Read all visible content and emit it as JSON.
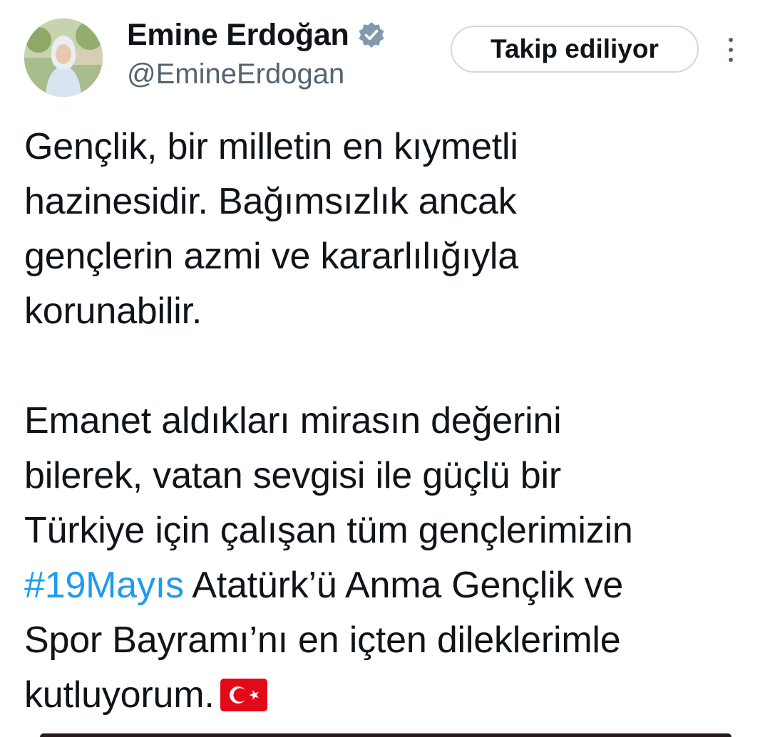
{
  "user": {
    "display_name": "Emine Erdoğan",
    "handle": "@EmineErdogan",
    "verified_badge_color": "#829aab"
  },
  "follow_button": {
    "label": "Takip ediliyor"
  },
  "tweet": {
    "paragraph1": [
      "Gençlik, bir milletin en kıymetli",
      "hazinesidir. Bağımsızlık ancak",
      "gençlerin azmi ve kararlılığıyla",
      "korunabilir."
    ],
    "paragraph2_lines": [
      "Emanet aldıkları mirasın değerini",
      "bilerek, vatan sevgisi ile güçlü bir",
      "Türkiye için çalışan tüm gençlerimizin"
    ],
    "hashtag": "#19Mayıs",
    "after_hashtag": " Atatürk’ü Anma Gençlik ve",
    "line_6": "Spor Bayramı’nı en içten dileklerimle",
    "line_7": "kutluyorum.",
    "emoji": "turkey-flag-icon"
  },
  "colors": {
    "hashtag": "#1d9bf0",
    "handle": "#536471",
    "text": "#0f1419"
  }
}
